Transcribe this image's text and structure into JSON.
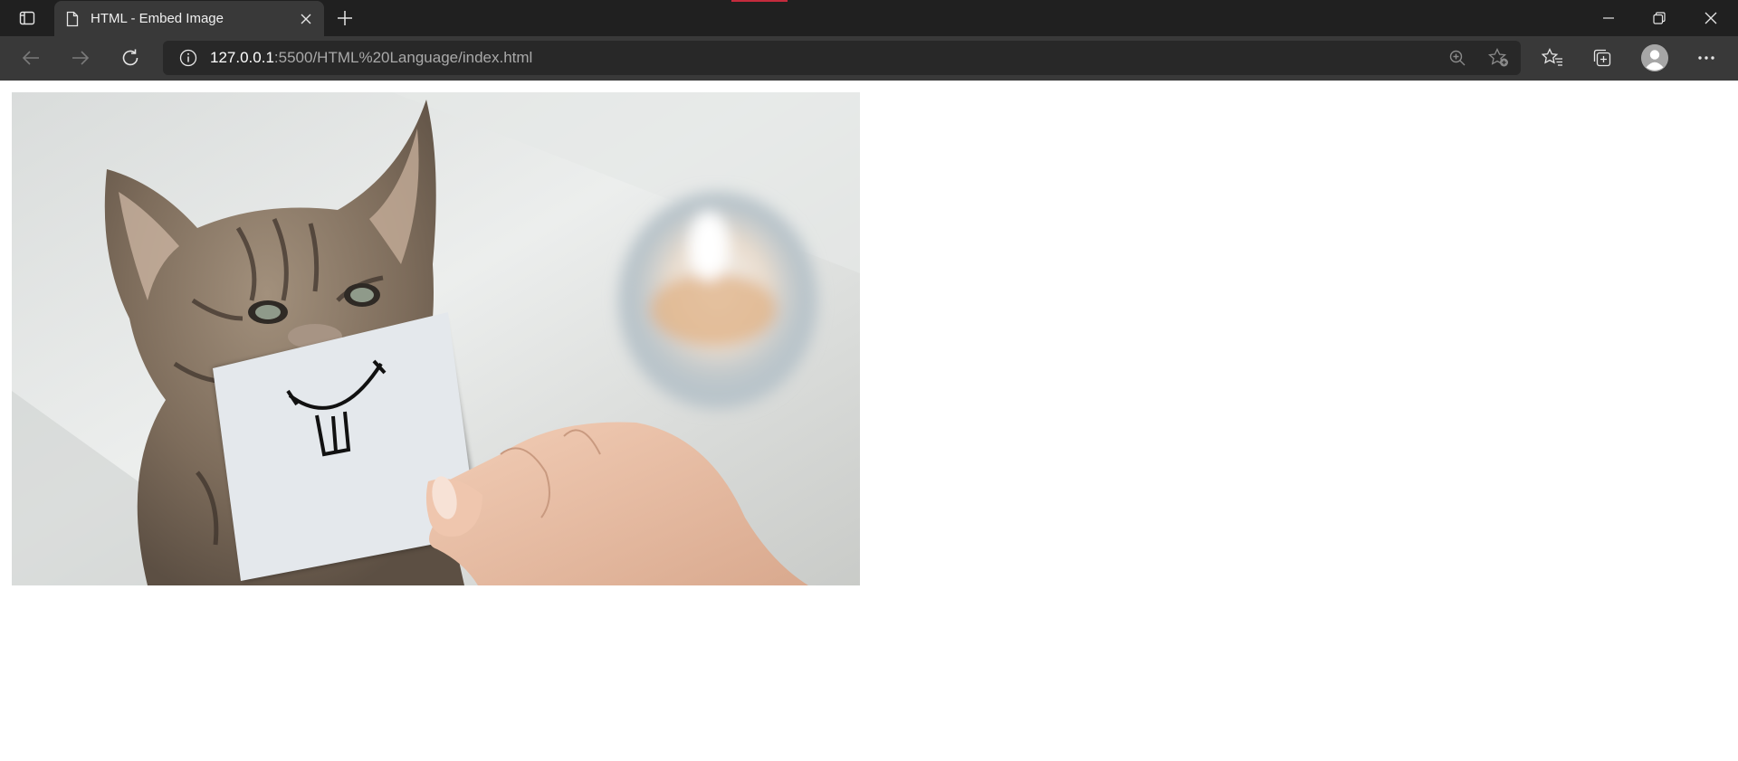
{
  "browser": {
    "tab": {
      "title": "HTML - Embed Image",
      "icon": "document-icon"
    },
    "address": {
      "host": "127.0.0.1",
      "rest": ":5500/HTML%20Language/index.html"
    },
    "accent_color": "#c42b3c"
  },
  "page": {
    "image": {
      "subject": "cat-with-smile-card",
      "alt": ""
    }
  }
}
